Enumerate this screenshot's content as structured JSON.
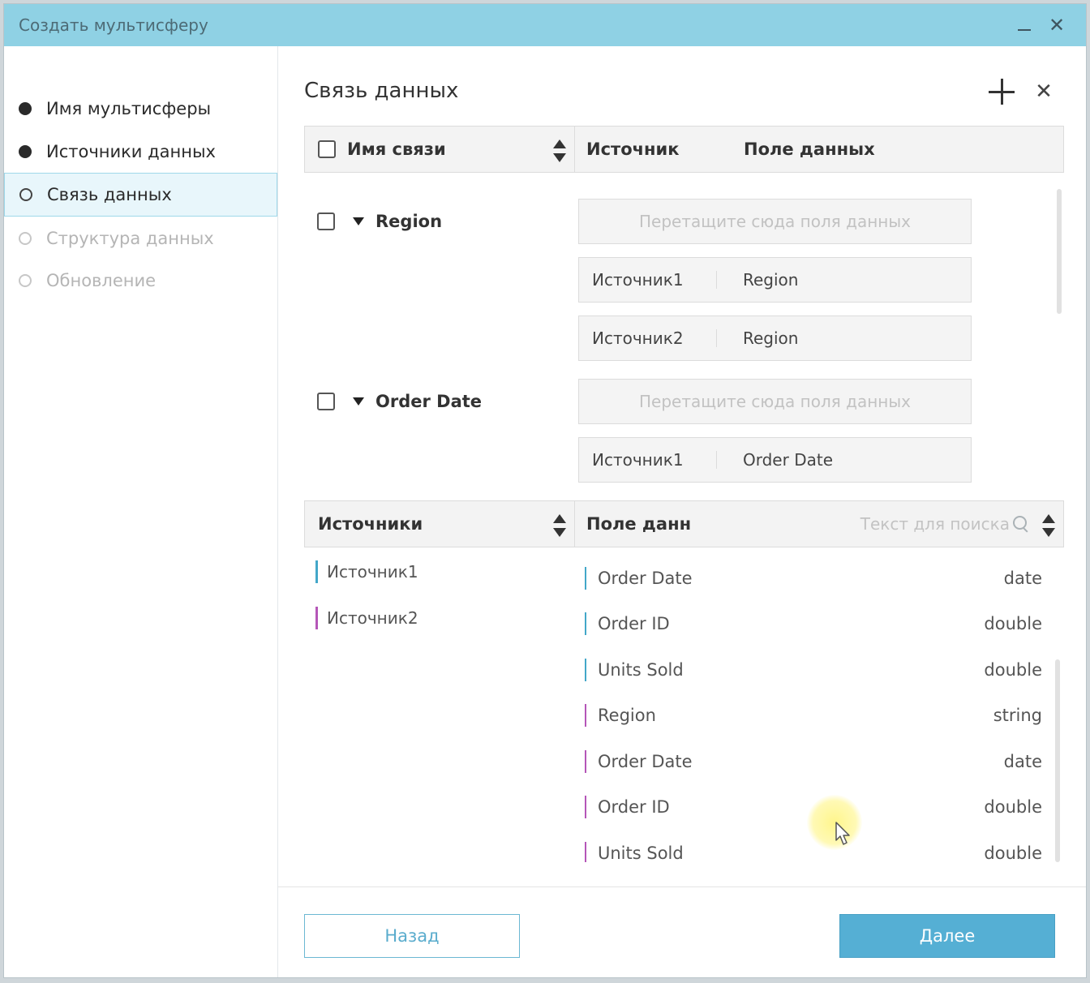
{
  "window": {
    "title": "Создать мультисферу"
  },
  "steps": [
    {
      "label": "Имя мультисферы",
      "state": "done"
    },
    {
      "label": "Источники данных",
      "state": "done"
    },
    {
      "label": "Связь данных",
      "state": "active"
    },
    {
      "label": "Структура данных",
      "state": "future"
    },
    {
      "label": "Обновление",
      "state": "future"
    }
  ],
  "main": {
    "title": "Связь данных",
    "relations_header": {
      "name": "Имя связи",
      "source": "Источник",
      "field": "Поле данных"
    },
    "relations": [
      {
        "name": "Region",
        "placeholder": "Перетащите сюда поля данных",
        "links": [
          {
            "source": "Источник1",
            "field": "Region"
          },
          {
            "source": "Источник2",
            "field": "Region"
          }
        ]
      },
      {
        "name": "Order Date",
        "placeholder": "Перетащите сюда поля данных",
        "links": [
          {
            "source": "Источник1",
            "field": "Order Date"
          }
        ]
      }
    ],
    "sources_header": "Источники",
    "fields_header": "Поле данн",
    "search_placeholder": "Текст для поиска",
    "sources": [
      "Источник1",
      "Источник2"
    ],
    "fields": [
      {
        "name": "Order Date",
        "type": "date",
        "source_index": 0
      },
      {
        "name": "Order ID",
        "type": "double",
        "source_index": 0
      },
      {
        "name": "Units Sold",
        "type": "double",
        "source_index": 0
      },
      {
        "name": "Region",
        "type": "string",
        "source_index": 1
      },
      {
        "name": "Order Date",
        "type": "date",
        "source_index": 1
      },
      {
        "name": "Order ID",
        "type": "double",
        "source_index": 1
      },
      {
        "name": "Units Sold",
        "type": "double",
        "source_index": 1
      }
    ]
  },
  "footer": {
    "back_label": "Назад",
    "next_label": "Далее"
  },
  "colors": {
    "titlebar": "#8fd1e4",
    "accent": "#55afd4",
    "source1": "#43a7c9",
    "source2": "#b556b8"
  }
}
